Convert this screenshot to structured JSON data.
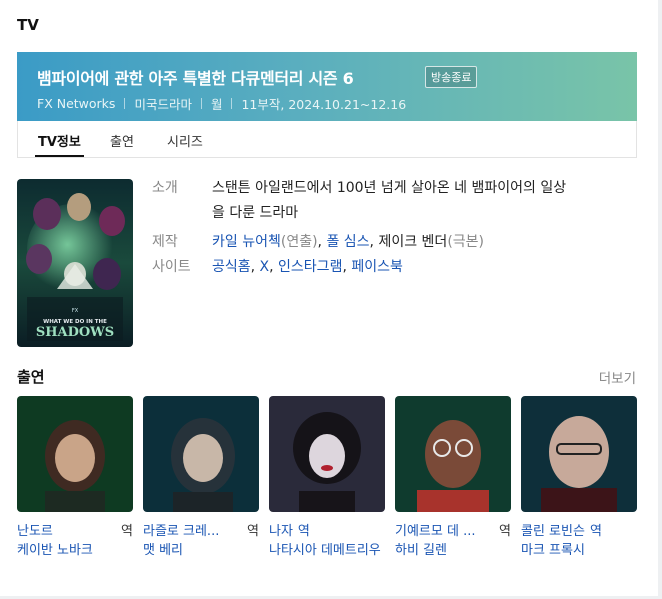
{
  "section": {
    "title": "TV"
  },
  "hero": {
    "title": "뱀파이어에 관한 아주 특별한 다큐멘터리 시즌 6",
    "status": "방송종료",
    "meta": [
      "FX Networks",
      "미국드라마",
      "월",
      "11부작, 2024.10.21~12.16"
    ]
  },
  "tabs": [
    {
      "label": "TV정보",
      "active": true
    },
    {
      "label": "출연",
      "active": false
    },
    {
      "label": "시리즈",
      "active": false
    }
  ],
  "poster": {
    "network": "FX",
    "title_line1": "WHAT WE DO IN THE",
    "title_line2": "SHADOWS"
  },
  "info": {
    "synopsis_label": "소개",
    "synopsis_line1": "스탠튼 아일랜드에서 100년 넘게 살아온 네 뱀파이어의 일상",
    "synopsis_line2": "을 다룬 드라마",
    "production_label": "제작",
    "production": {
      "p1": "카일 뉴어첵",
      "r1": "(연출)",
      "sep1": ", ",
      "p2": "폴 심스",
      "sep2": ", ",
      "p3": "제이크 벤더",
      "r2": "(극본)"
    },
    "site_label": "사이트",
    "sites": {
      "s1": "공식홈",
      "sep1": ", ",
      "s2": "X",
      "sep2": ", ",
      "s3": "인스타그램",
      "sep3": ", ",
      "s4": "페이스북"
    }
  },
  "cast": {
    "title": "출연",
    "more": "더보기",
    "members": [
      {
        "role": "난도르",
        "suffix": "역",
        "actor": "케이반 노바크",
        "colors": [
          "#0e3a22",
          "#3f2a22"
        ]
      },
      {
        "role": "라즐로 크레...",
        "suffix": "역",
        "actor": "맷 베리",
        "colors": [
          "#0c2f3a",
          "#26323a"
        ]
      },
      {
        "role": "나자",
        "suffix": "역",
        "actor": "나타시아 데메트리우",
        "colors": [
          "#2a2a3a",
          "#ddd6dd"
        ]
      },
      {
        "role": "기예르모 데 ...",
        "suffix": "역",
        "actor": "하비 길렌",
        "colors": [
          "#0f3b2e",
          "#a8332c"
        ]
      },
      {
        "role": "콜린 로빈슨",
        "suffix": "역",
        "actor": "마크 프록시",
        "colors": [
          "#0e2f3a",
          "#3c1418"
        ]
      }
    ]
  },
  "colors": {
    "hero_start": "#3b9bc6",
    "hero_end": "#79c4a8",
    "link": "#1a55b3",
    "label": "#888888"
  }
}
